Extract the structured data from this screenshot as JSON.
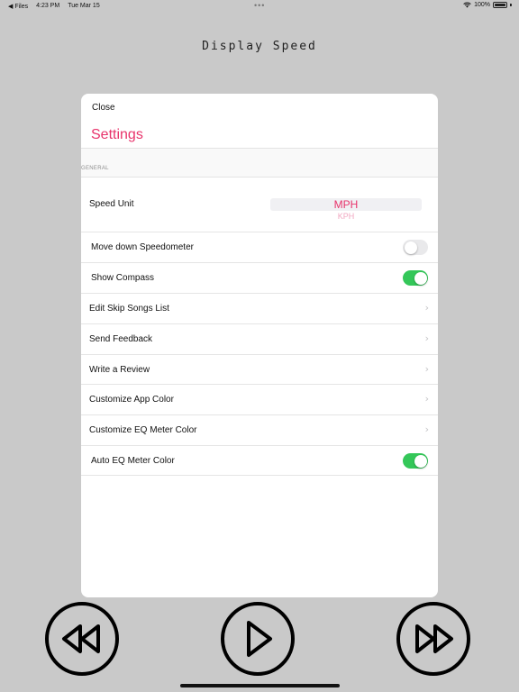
{
  "status_bar": {
    "back_app": "◀ Files",
    "time": "4:23 PM",
    "date": "Tue Mar 15",
    "center_dots": "•••",
    "battery_percent": "100%"
  },
  "app": {
    "title": "Display Speed"
  },
  "settings_sheet": {
    "close_label": "Close",
    "title": "Settings",
    "section_header": "GENERAL",
    "speed_unit": {
      "label": "Speed Unit",
      "selected": "MPH",
      "next_option": "KPH"
    },
    "rows": {
      "move_down_speedometer": {
        "label": "Move down Speedometer",
        "on": false
      },
      "show_compass": {
        "label": "Show Compass",
        "on": true
      },
      "edit_skip_songs": {
        "label": "Edit Skip Songs List"
      },
      "send_feedback": {
        "label": "Send Feedback"
      },
      "write_review": {
        "label": "Write a Review"
      },
      "customize_app_color": {
        "label": "Customize App Color"
      },
      "customize_eq_color": {
        "label": "Customize EQ Meter Color"
      },
      "auto_eq_color": {
        "label": "Auto EQ Meter Color",
        "on": true
      }
    },
    "chevron": "›",
    "colors": {
      "accent": "#e8336b",
      "toggle_on": "#34c759"
    }
  },
  "media_controls": {
    "rewind": "rewind-icon",
    "play": "play-icon",
    "fast_forward": "fast-forward-icon"
  }
}
